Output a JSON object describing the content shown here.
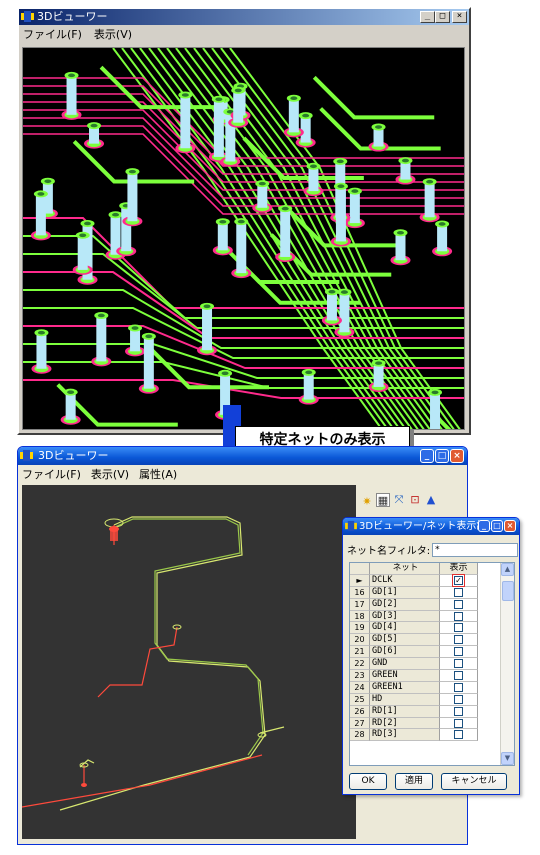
{
  "window1": {
    "title": "3Dビューワー",
    "menu": [
      "ファイル(F)",
      "表示(V)"
    ],
    "controls": {
      "minimize": "_",
      "maximize": "□",
      "close": "×"
    }
  },
  "callout": {
    "text": "特定ネットのみ表示"
  },
  "window2": {
    "title": "3Dビューワー",
    "menu": [
      "ファイル(F)",
      "表示(V)",
      "属性(A)"
    ]
  },
  "dialog": {
    "title": "3Dビューワー/ネット表示設...",
    "filter_label": "ネット名フィルタ:",
    "filter_value": "*",
    "columns": [
      "ネット",
      "表示"
    ],
    "rows": [
      {
        "num": "►",
        "name": "DCLK",
        "shown": true
      },
      {
        "num": "16",
        "name": "GD[1]",
        "shown": false
      },
      {
        "num": "17",
        "name": "GD[2]",
        "shown": false
      },
      {
        "num": "18",
        "name": "GD[3]",
        "shown": false
      },
      {
        "num": "19",
        "name": "GD[4]",
        "shown": false
      },
      {
        "num": "20",
        "name": "GD[5]",
        "shown": false
      },
      {
        "num": "21",
        "name": "GD[6]",
        "shown": false
      },
      {
        "num": "22",
        "name": "GND",
        "shown": false
      },
      {
        "num": "23",
        "name": "GREEN",
        "shown": false
      },
      {
        "num": "24",
        "name": "GREEN1",
        "shown": false
      },
      {
        "num": "25",
        "name": "HD",
        "shown": false
      },
      {
        "num": "26",
        "name": "RD[1]",
        "shown": false
      },
      {
        "num": "27",
        "name": "RD[2]",
        "shown": false
      },
      {
        "num": "28",
        "name": "RD[3]",
        "shown": false
      }
    ],
    "buttons": {
      "ok": "OK",
      "apply": "適用",
      "cancel": "キャンセル"
    }
  },
  "colors": {
    "trace_green": "#7dff3c",
    "trace_pink": "#ff2a8c",
    "via_blue": "#b8e8f8",
    "net_red": "#ff4a3c",
    "net_yellow": "#d8e870"
  }
}
